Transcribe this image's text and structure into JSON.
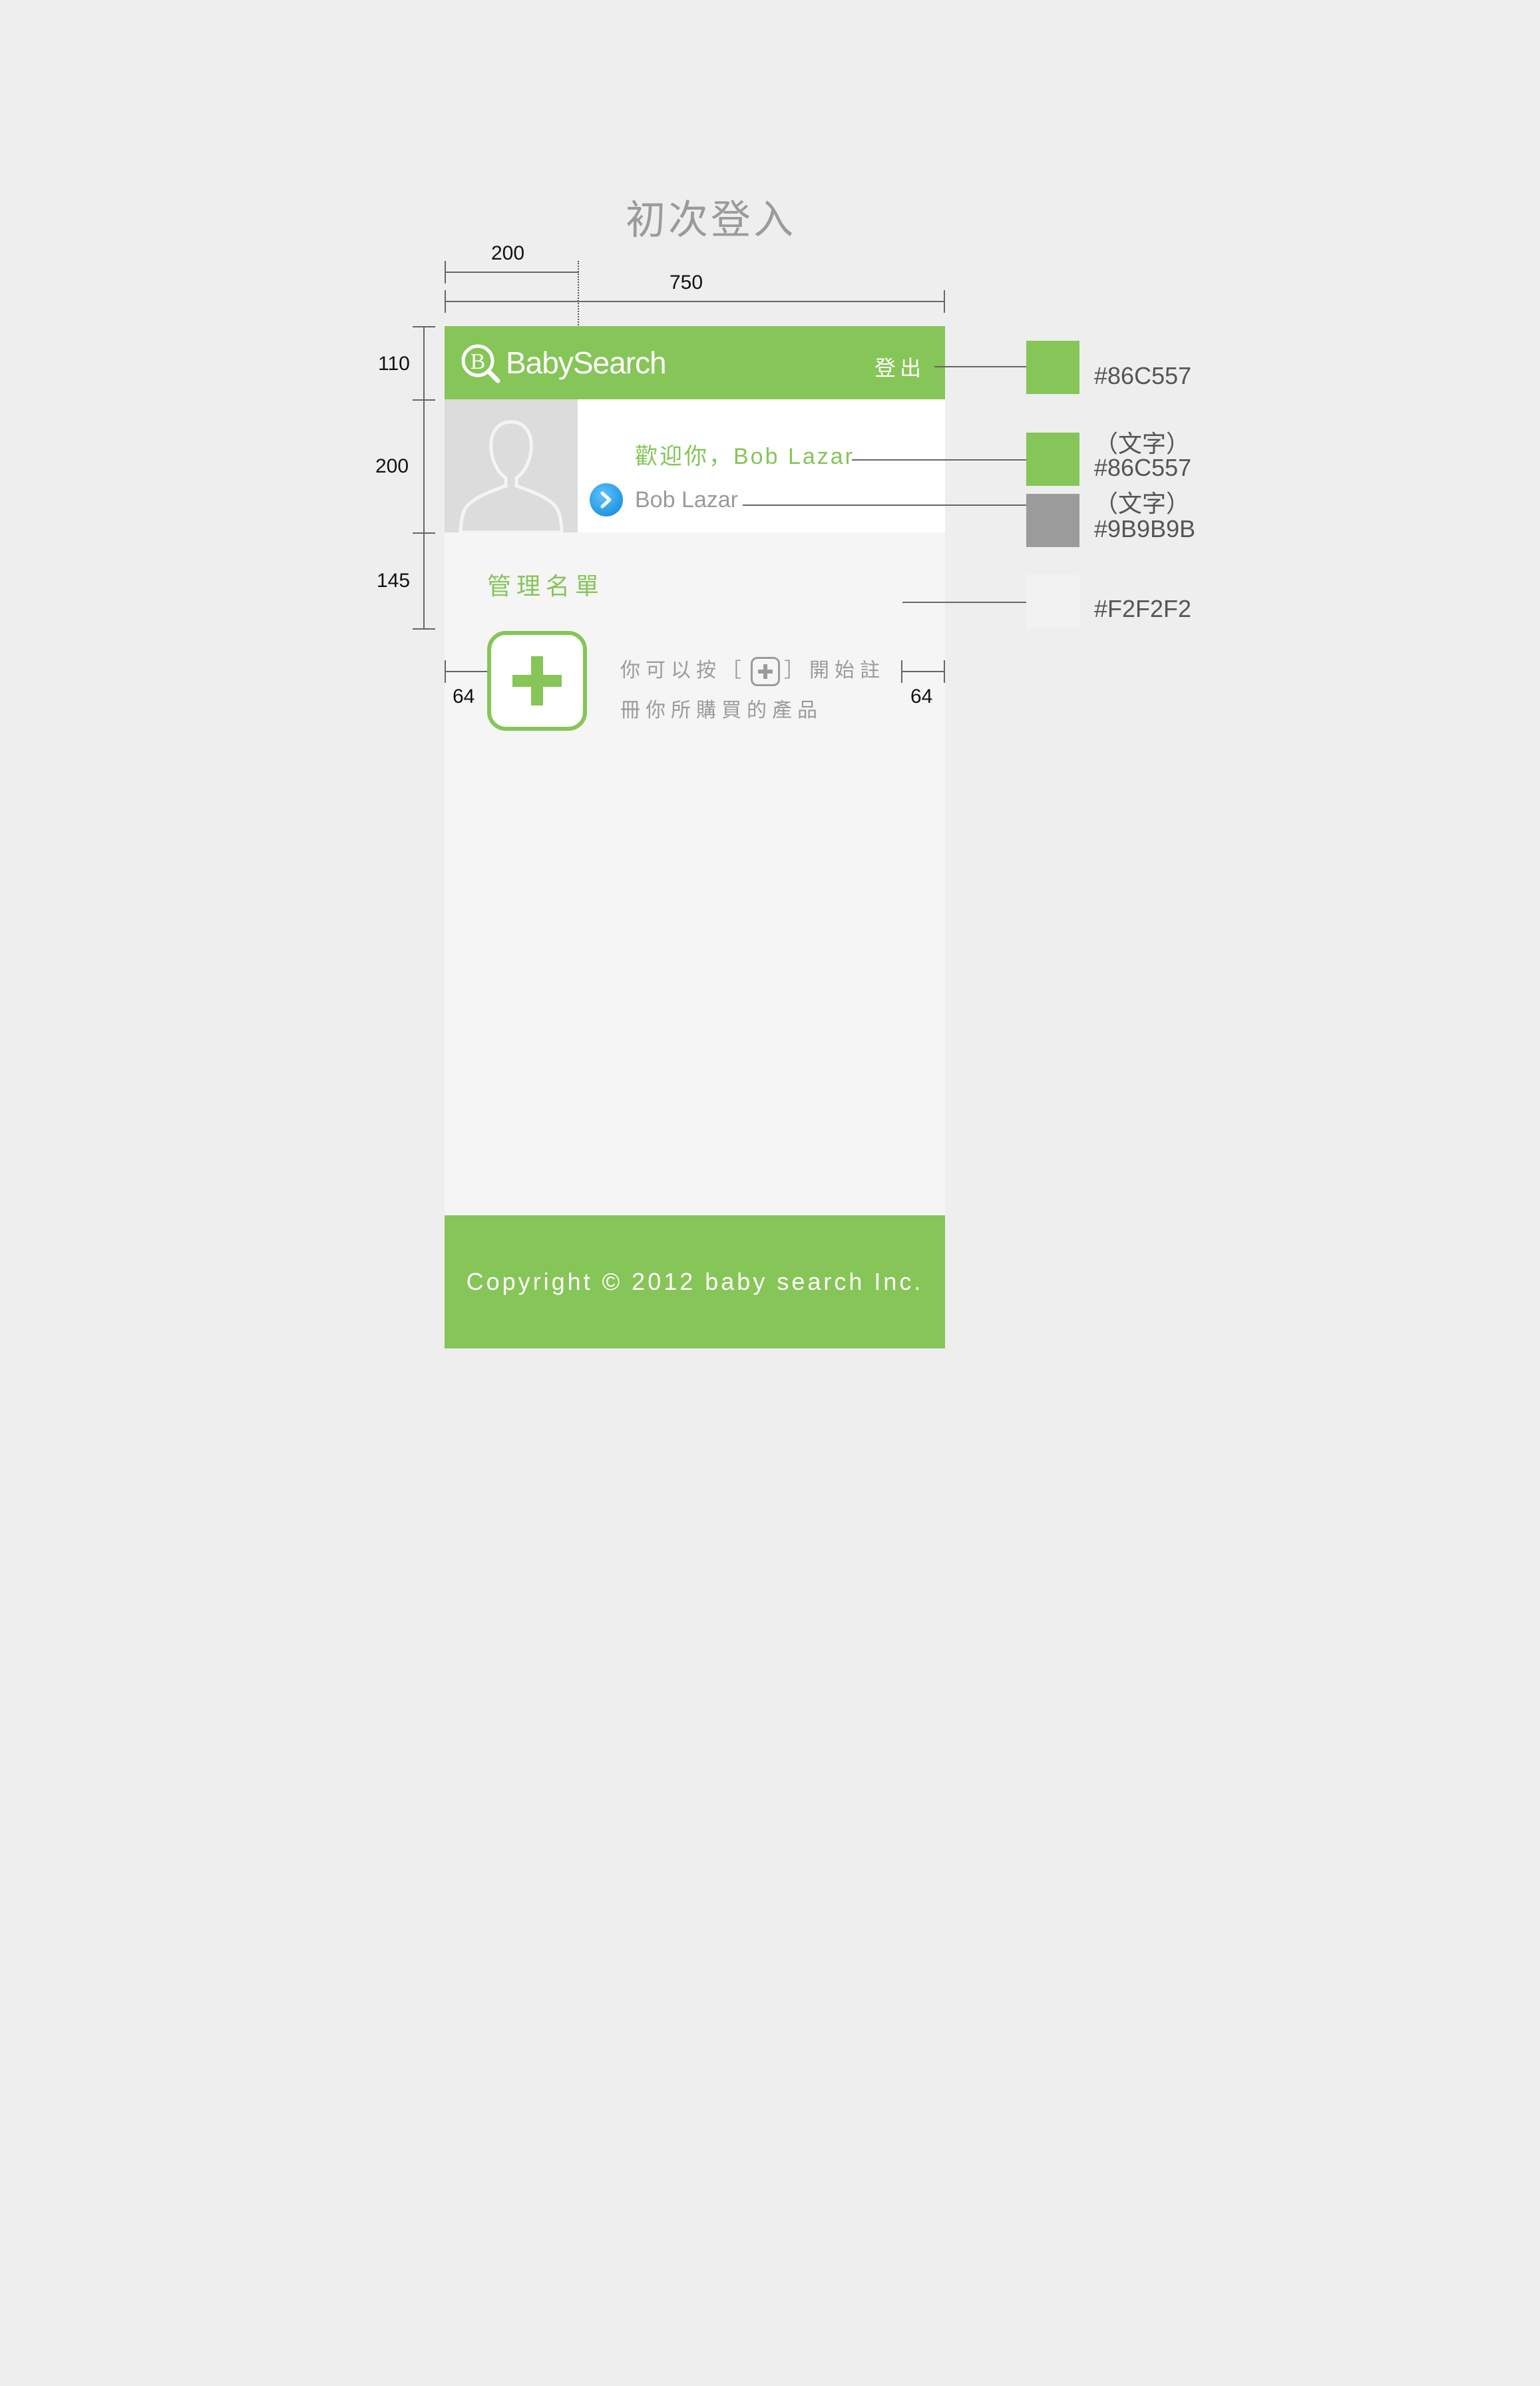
{
  "page_title": "初次登入",
  "dimensions": {
    "content_width": "750",
    "avatar_width": "200",
    "header_height": "110",
    "profile_height": "200",
    "manage_height": "145",
    "left_padding": "64",
    "right_padding": "64"
  },
  "header": {
    "logo_mark": "B",
    "logo_text": "BabySearch",
    "logout_label": "登出"
  },
  "profile": {
    "welcome_text": "歡迎你，Bob Lazar",
    "username": "Bob Lazar"
  },
  "manage": {
    "title": "管理名單",
    "hint_line1_before": "你可以按［",
    "hint_line1_after": "］開始註",
    "hint_line2": "冊你所購買的產品"
  },
  "footer": {
    "copyright": "Copyright © 2012 baby search Inc."
  },
  "swatches": [
    {
      "note": "",
      "hex": "#86C557",
      "color": "#86C557"
    },
    {
      "note": "（文字）",
      "hex": "#86C557",
      "color": "#86C557"
    },
    {
      "note": "（文字）",
      "hex": "#9B9B9B",
      "color": "#9B9B9B"
    },
    {
      "note": "",
      "hex": "#F2F2F2",
      "color": "#F2F2F2"
    }
  ]
}
